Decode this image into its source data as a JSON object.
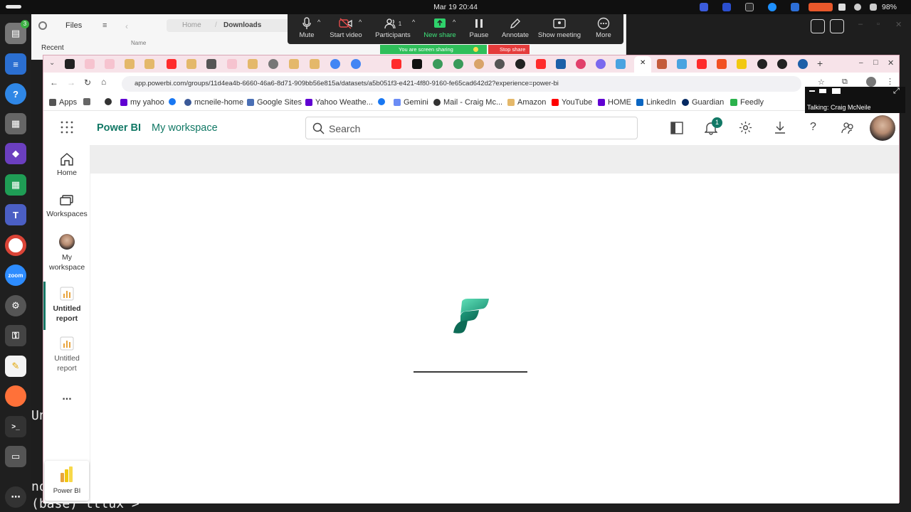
{
  "system": {
    "clock": "Mar 19  20:44",
    "battery": "98%"
  },
  "files": {
    "title": "Files",
    "recent": "Recent",
    "path_home": "Home",
    "path_folder": "Downloads",
    "column_name": "Name"
  },
  "zoom": {
    "buttons": [
      {
        "label": "Mute"
      },
      {
        "label": "Start video"
      },
      {
        "label": "Participants",
        "count": "1"
      },
      {
        "label": "New share"
      },
      {
        "label": "Pause"
      },
      {
        "label": "Annotate"
      },
      {
        "label": "Show meeting"
      },
      {
        "label": "More"
      }
    ],
    "sharing": "You are screen sharing",
    "stop": "Stop share",
    "talking": "Talking: Craig McNeile"
  },
  "browser": {
    "url": "app.powerbi.com/groups/11d4ea4b-6660-46a6-8d71-909bb56e815a/datasets/a5b051f3-e421-4f80-9160-fe65cad642d2?experience=power-bi",
    "bookmarks": [
      "Apps",
      "my yahoo",
      "mcneile-home",
      "Google Sites",
      "Yahoo Weathe...",
      "Gemini",
      "Mail - Craig Mc...",
      "Amazon",
      "YouTube",
      "HOME",
      "LinkedIn",
      "Guardian",
      "Feedly"
    ]
  },
  "powerbi": {
    "brand": "Power BI",
    "workspace": "My workspace",
    "search_placeholder": "Search",
    "notification_count": "1",
    "nav": [
      {
        "label": "Home"
      },
      {
        "label": "Workspaces"
      },
      {
        "label": "My workspace"
      },
      {
        "label": "Untitled report",
        "active": true
      },
      {
        "label": "Untitled report"
      }
    ],
    "more": "...",
    "switcher_label": "Power BI"
  },
  "terminal": {
    "line1": "Un",
    "line2": "no",
    "prompt": "(base) ttlux >"
  },
  "colors": {
    "pbi_green": "#117865",
    "accent_tab": "#f7e3e9"
  }
}
